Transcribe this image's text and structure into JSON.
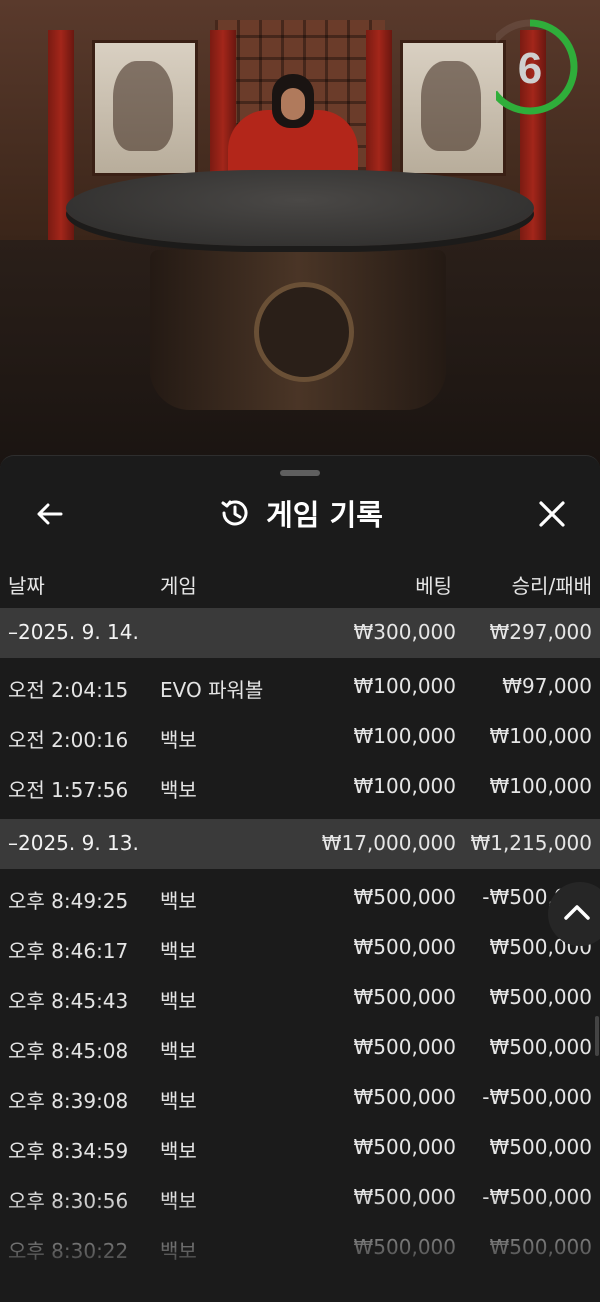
{
  "timer": {
    "value": "6",
    "progress": 0.65,
    "color": "#2fae3a"
  },
  "header": {
    "title": "게임 기록",
    "back_icon": "arrow-left-icon",
    "history_icon": "history-clock-icon",
    "close_icon": "close-x-icon"
  },
  "columns": {
    "date": "날짜",
    "game": "게임",
    "bet": "베팅",
    "win_loss": "승리/패배"
  },
  "rows": [
    {
      "type": "group",
      "time": "–2025. 9. 14.",
      "game": "",
      "bet": "₩300,000",
      "result": "₩297,000"
    },
    {
      "type": "item",
      "time": "오전 2:04:15",
      "game": "EVO 파워볼",
      "bet": "₩100,000",
      "result": "₩97,000"
    },
    {
      "type": "item",
      "time": "오전 2:00:16",
      "game": "백보",
      "bet": "₩100,000",
      "result": "₩100,000"
    },
    {
      "type": "item",
      "time": "오전 1:57:56",
      "game": "백보",
      "bet": "₩100,000",
      "result": "₩100,000"
    },
    {
      "type": "group",
      "time": "–2025. 9. 13.",
      "game": "",
      "bet": "₩17,000,000",
      "result": "₩1,215,000"
    },
    {
      "type": "item",
      "time": "오후 8:49:25",
      "game": "백보",
      "bet": "₩500,000",
      "result": "-₩500,000"
    },
    {
      "type": "item",
      "time": "오후 8:46:17",
      "game": "백보",
      "bet": "₩500,000",
      "result": "₩500,000"
    },
    {
      "type": "item",
      "time": "오후 8:45:43",
      "game": "백보",
      "bet": "₩500,000",
      "result": "₩500,000"
    },
    {
      "type": "item",
      "time": "오후 8:45:08",
      "game": "백보",
      "bet": "₩500,000",
      "result": "₩500,000"
    },
    {
      "type": "item",
      "time": "오후 8:39:08",
      "game": "백보",
      "bet": "₩500,000",
      "result": "-₩500,000"
    },
    {
      "type": "item",
      "time": "오후 8:34:59",
      "game": "백보",
      "bet": "₩500,000",
      "result": "₩500,000"
    },
    {
      "type": "item",
      "time": "오후 8:30:56",
      "game": "백보",
      "bet": "₩500,000",
      "result": "-₩500,000"
    },
    {
      "type": "item",
      "time": "오후 8:30:22",
      "game": "백보",
      "bet": "₩500,000",
      "result": "₩500,000"
    }
  ],
  "scroll_top_icon": "chevron-up-icon"
}
